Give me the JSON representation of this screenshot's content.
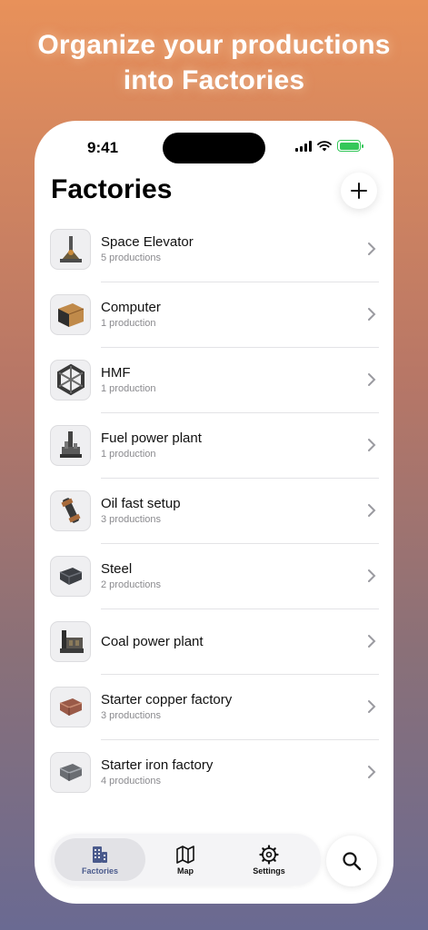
{
  "headline": {
    "line1": "Organize your productions",
    "line2": "into Factories"
  },
  "status_bar": {
    "time": "9:41",
    "icons": [
      "cellular-signal-icon",
      "wifi-icon",
      "battery-charging-icon"
    ],
    "battery_color": "#34c759"
  },
  "header": {
    "title": "Factories",
    "add_icon": "plus-icon"
  },
  "factories": [
    {
      "name": "Space Elevator",
      "count": "5 productions",
      "icon": "space-elevator-icon"
    },
    {
      "name": "Computer",
      "count": "1 production",
      "icon": "computer-icon"
    },
    {
      "name": "HMF",
      "count": "1 production",
      "icon": "hmf-icon"
    },
    {
      "name": "Fuel power plant",
      "count": "1 production",
      "icon": "fuel-generator-icon"
    },
    {
      "name": "Oil fast setup",
      "count": "3 productions",
      "icon": "oil-pipe-icon"
    },
    {
      "name": "Steel",
      "count": "2 productions",
      "icon": "steel-ingot-icon"
    },
    {
      "name": "Coal power plant",
      "count": "",
      "icon": "coal-generator-icon"
    },
    {
      "name": "Starter copper factory",
      "count": "3 productions",
      "icon": "copper-ingot-icon"
    },
    {
      "name": "Starter iron factory",
      "count": "4 productions",
      "icon": "iron-ingot-icon"
    }
  ],
  "tabbar": {
    "tabs": [
      {
        "label": "Factories",
        "icon": "buildings-icon",
        "active": true
      },
      {
        "label": "Map",
        "icon": "map-icon",
        "active": false
      },
      {
        "label": "Settings",
        "icon": "gear-icon",
        "active": false
      }
    ],
    "active_color": "#4a5a8c",
    "search_icon": "search-icon"
  }
}
